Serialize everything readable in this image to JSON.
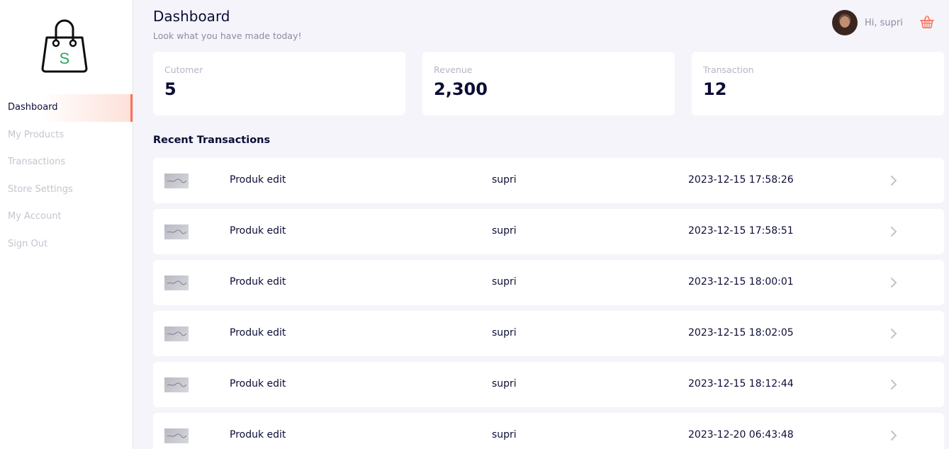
{
  "sidebar": {
    "logo_letter": "S",
    "items": [
      {
        "label": "Dashboard",
        "active": true
      },
      {
        "label": "My Products"
      },
      {
        "label": "Transactions"
      },
      {
        "label": "Store Settings"
      },
      {
        "label": "My Account"
      },
      {
        "label": "Sign Out"
      }
    ]
  },
  "header": {
    "title": "Dashboard",
    "subtitle": "Look what you have made today!",
    "greeting": "Hi, supri",
    "cart_icon": "basket-icon"
  },
  "stats": [
    {
      "label": "Cutomer",
      "value": "5"
    },
    {
      "label": "Revenue",
      "value": "2,300"
    },
    {
      "label": "Transaction",
      "value": "12"
    }
  ],
  "recent": {
    "title": "Recent Transactions",
    "rows": [
      {
        "name": "Produk edit",
        "user": "supri",
        "date": "2023-12-15 17:58:26"
      },
      {
        "name": "Produk edit",
        "user": "supri",
        "date": "2023-12-15 17:58:51"
      },
      {
        "name": "Produk edit",
        "user": "supri",
        "date": "2023-12-15 18:00:01"
      },
      {
        "name": "Produk edit",
        "user": "supri",
        "date": "2023-12-15 18:02:05"
      },
      {
        "name": "Produk edit",
        "user": "supri",
        "date": "2023-12-15 18:12:44"
      },
      {
        "name": "Produk edit",
        "user": "supri",
        "date": "2023-12-20 06:43:48"
      }
    ]
  },
  "colors": {
    "accent": "#ff7158",
    "logo_green": "#29a867",
    "text_dark": "#0c0d36",
    "text_muted": "#c4c4cf"
  }
}
